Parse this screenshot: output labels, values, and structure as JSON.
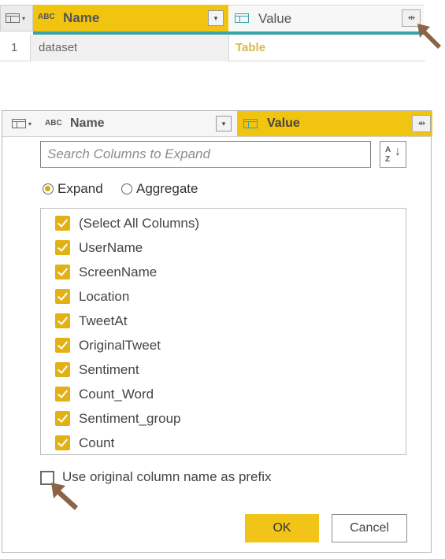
{
  "top_grid": {
    "columns": [
      {
        "type_badge": "ABC",
        "name": "Name",
        "dropdown": "▾"
      },
      {
        "name": "Value",
        "expand_glyph": "⇹"
      }
    ],
    "rows": [
      {
        "index": "1",
        "name": "dataset",
        "value": "Table"
      }
    ]
  },
  "dialog_header": {
    "columns": [
      {
        "type_badge": "ABC",
        "name": "Name",
        "dropdown": "▾"
      },
      {
        "name": "Value",
        "expand_glyph": "⇹"
      }
    ]
  },
  "expand_dialog": {
    "search": {
      "placeholder": "Search Columns to Expand",
      "value": ""
    },
    "sort_button": {
      "top": "A",
      "bottom": "Z",
      "arrow": "↓"
    },
    "mode": {
      "options": [
        {
          "label": "Expand",
          "selected": true
        },
        {
          "label": "Aggregate",
          "selected": false
        }
      ]
    },
    "columns": [
      {
        "label": "(Select All Columns)",
        "checked": true
      },
      {
        "label": "UserName",
        "checked": true
      },
      {
        "label": "ScreenName",
        "checked": true
      },
      {
        "label": "Location",
        "checked": true
      },
      {
        "label": "TweetAt",
        "checked": true
      },
      {
        "label": "OriginalTweet",
        "checked": true
      },
      {
        "label": "Sentiment",
        "checked": true
      },
      {
        "label": "Count_Word",
        "checked": true
      },
      {
        "label": "Sentiment_group",
        "checked": true
      },
      {
        "label": "Count",
        "checked": true
      }
    ],
    "prefix_option": {
      "label": "Use original column name as prefix",
      "checked": false
    },
    "buttons": {
      "ok": "OK",
      "cancel": "Cancel"
    }
  },
  "colors": {
    "accent_yellow": "#f2c417",
    "checkbox_yellow": "#e2b215",
    "teal_rule": "#3aa3a8",
    "value_table_text": "#d9b84a",
    "pointer_arrow": "#8b6448"
  }
}
